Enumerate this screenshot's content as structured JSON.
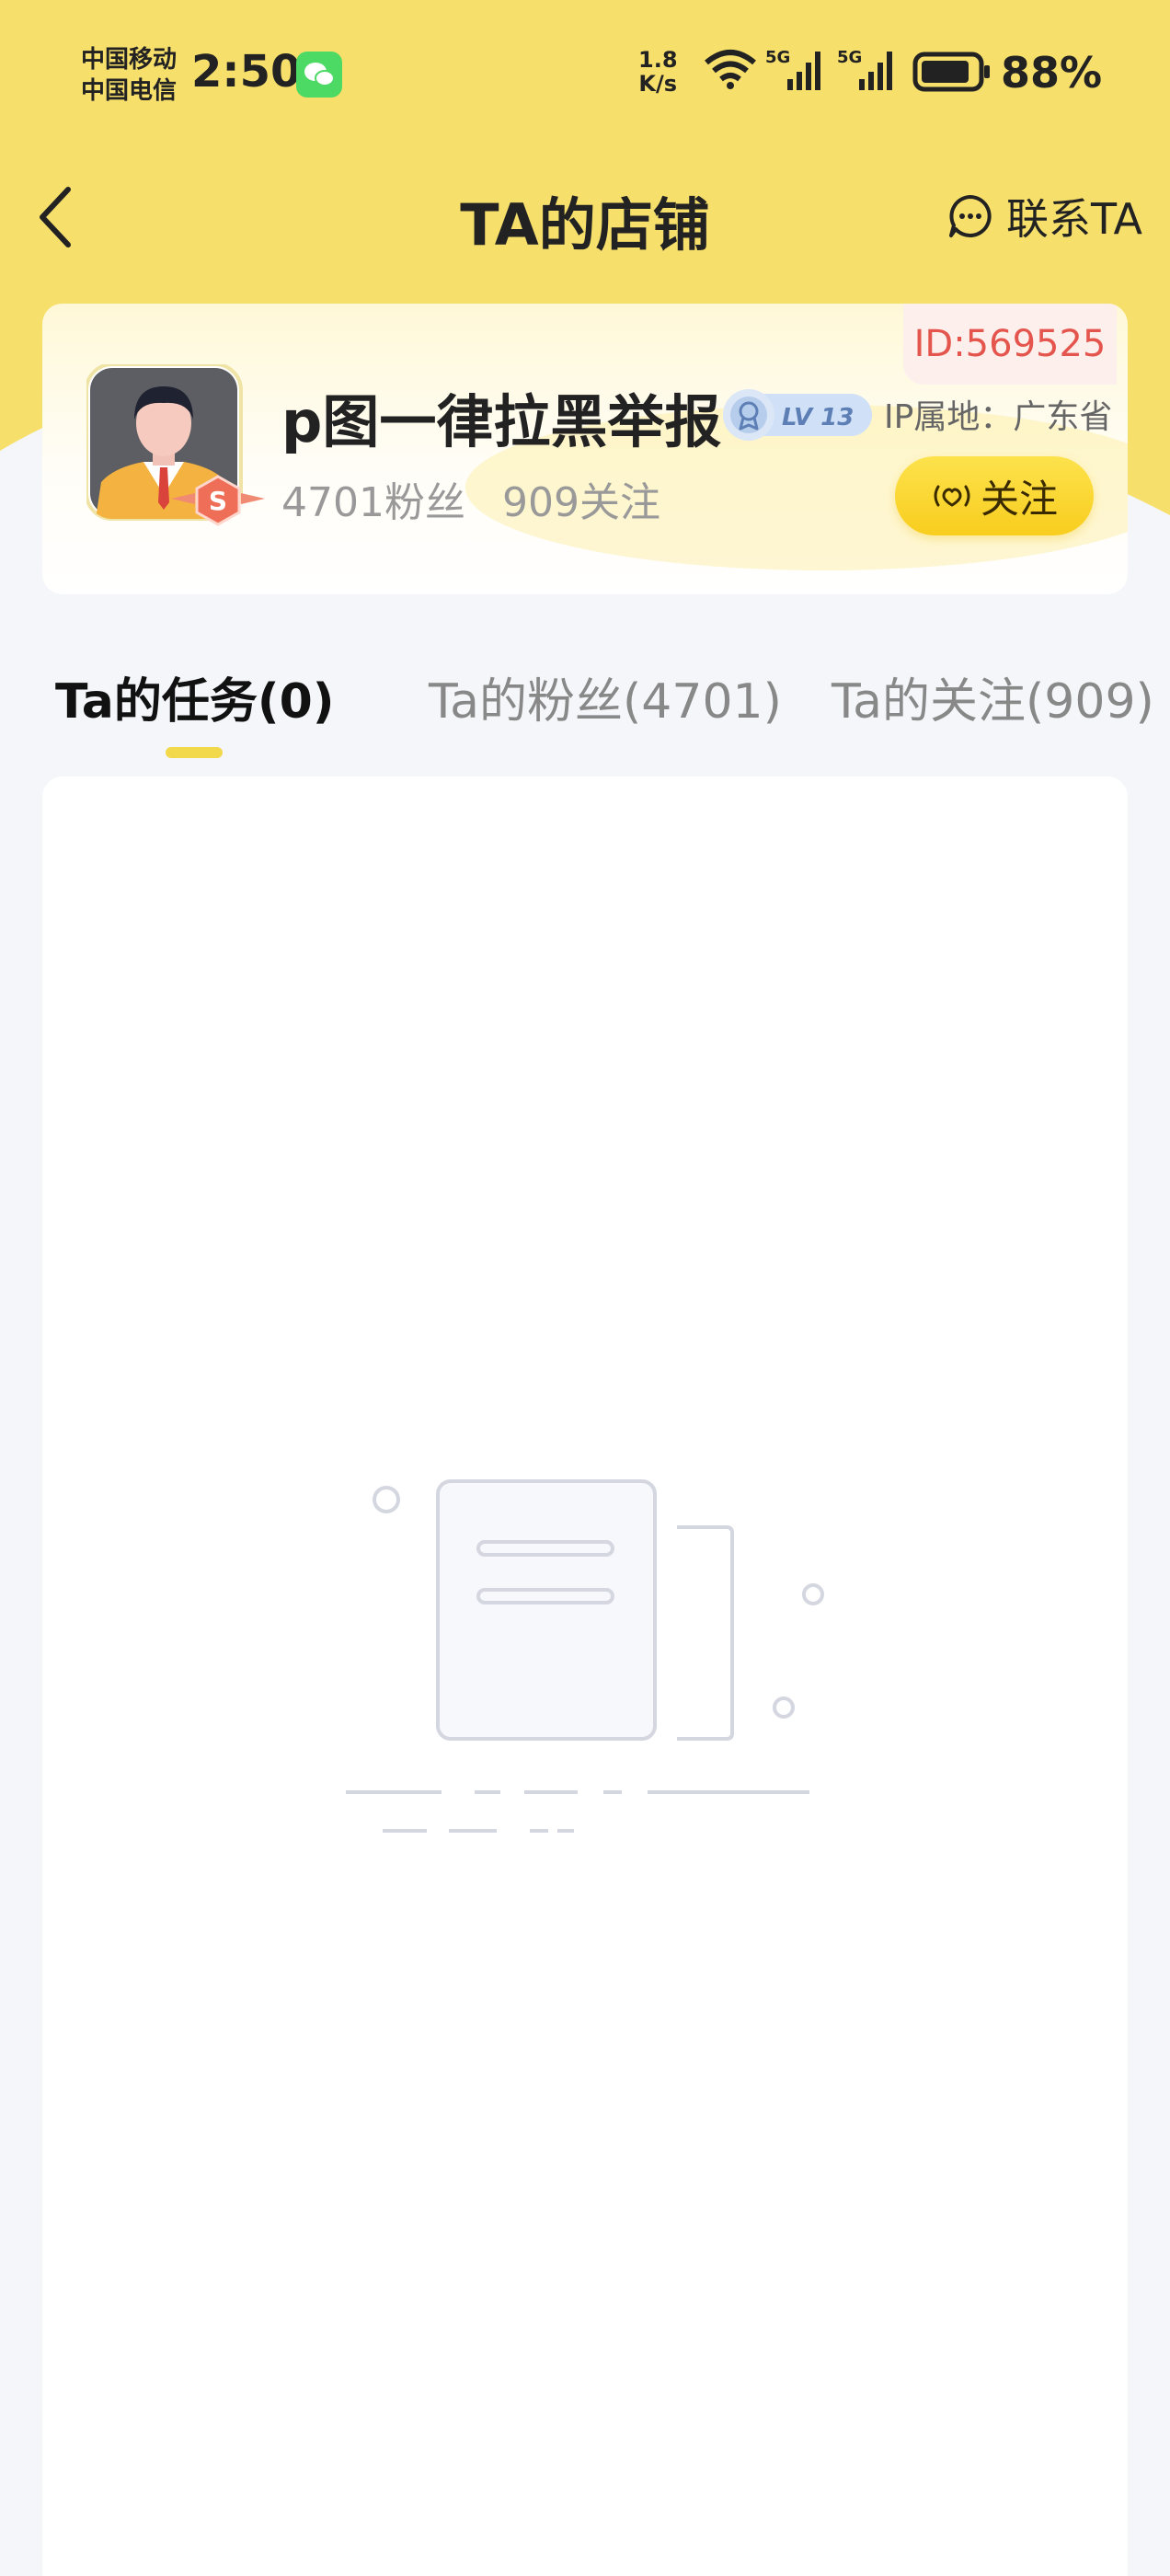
{
  "status_bar": {
    "carrier_1": "中国移动",
    "carrier_2": "中国电信",
    "time": "2:50",
    "speed_value": "1.8",
    "speed_unit": "K/s",
    "signal_1": "5G",
    "signal_2": "5G",
    "battery": "88%",
    "battery_level": 0.88,
    "icons": [
      "wechat-icon",
      "wifi-icon",
      "signal-icon",
      "battery-icon"
    ]
  },
  "nav": {
    "title": "TA的店铺",
    "contact_label": "联系TA",
    "icons": [
      "back-arrow-icon",
      "chat-bubble-icon"
    ]
  },
  "profile": {
    "id_label": "ID:569525",
    "name": "p图一律拉黑举报",
    "level": "LV 13",
    "ip_location": "IP属地：广东省",
    "fans": "4701粉丝",
    "following": "909关注",
    "follow_button": "关注",
    "avatar_badge": "S"
  },
  "tabs": [
    {
      "label": "Ta的任务(0)",
      "active": true
    },
    {
      "label": "Ta的粉丝(4701)",
      "active": false
    },
    {
      "label": "Ta的关注(909)",
      "active": false
    }
  ],
  "colors": {
    "header_yellow": "#f6df6b",
    "accent_yellow": "#f8cd1e",
    "id_red": "#e4554d",
    "tab_underline": "#f2d94b"
  }
}
